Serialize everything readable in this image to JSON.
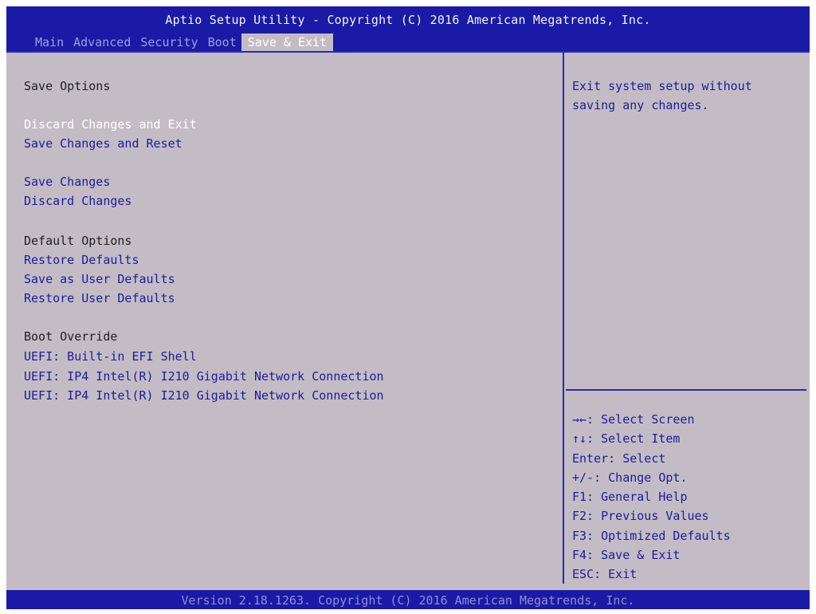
{
  "header": {
    "title": "Aptio Setup Utility - Copyright (C) 2016 American Megatrends, Inc.",
    "tabs": [
      {
        "label": "Main"
      },
      {
        "label": "Advanced"
      },
      {
        "label": "Security"
      },
      {
        "label": "Boot"
      },
      {
        "label": "Save & Exit",
        "active": true
      }
    ]
  },
  "main": {
    "save_options": {
      "heading": "Save Options",
      "discard_changes_and_exit": "Discard Changes and Exit",
      "save_changes_and_reset": "Save Changes and Reset",
      "save_changes": "Save Changes",
      "discard_changes": "Discard Changes"
    },
    "default_options": {
      "heading": "Default Options",
      "restore_defaults": "Restore Defaults",
      "save_as_user_defaults": "Save as User Defaults",
      "restore_user_defaults": "Restore User Defaults"
    },
    "boot_override": {
      "heading": "Boot Override",
      "items": [
        "UEFI: Built-in EFI Shell",
        "UEFI: IP4 Intel(R) I210 Gigabit  Network Connection",
        "UEFI: IP4 Intel(R) I210 Gigabit  Network Connection"
      ]
    },
    "selected_item": "Discard Changes and Exit"
  },
  "help": {
    "text": "Exit system setup without saving any changes."
  },
  "keys": [
    "→←: Select Screen",
    "↑↓: Select Item",
    "Enter: Select",
    "+/-: Change Opt.",
    "F1: General Help",
    "F2: Previous Values",
    "F3: Optimized Defaults",
    "F4: Save & Exit",
    "ESC: Exit"
  ],
  "footer": {
    "text": "Version 2.18.1263. Copyright (C) 2016 American Megatrends, Inc."
  },
  "colors": {
    "header_bg": "#1a1aa6",
    "panel_bg": "#c4bcc4",
    "option_text": "#1c1c9c",
    "selected_text": "#ffffff",
    "heading_text": "#1e1e24"
  }
}
